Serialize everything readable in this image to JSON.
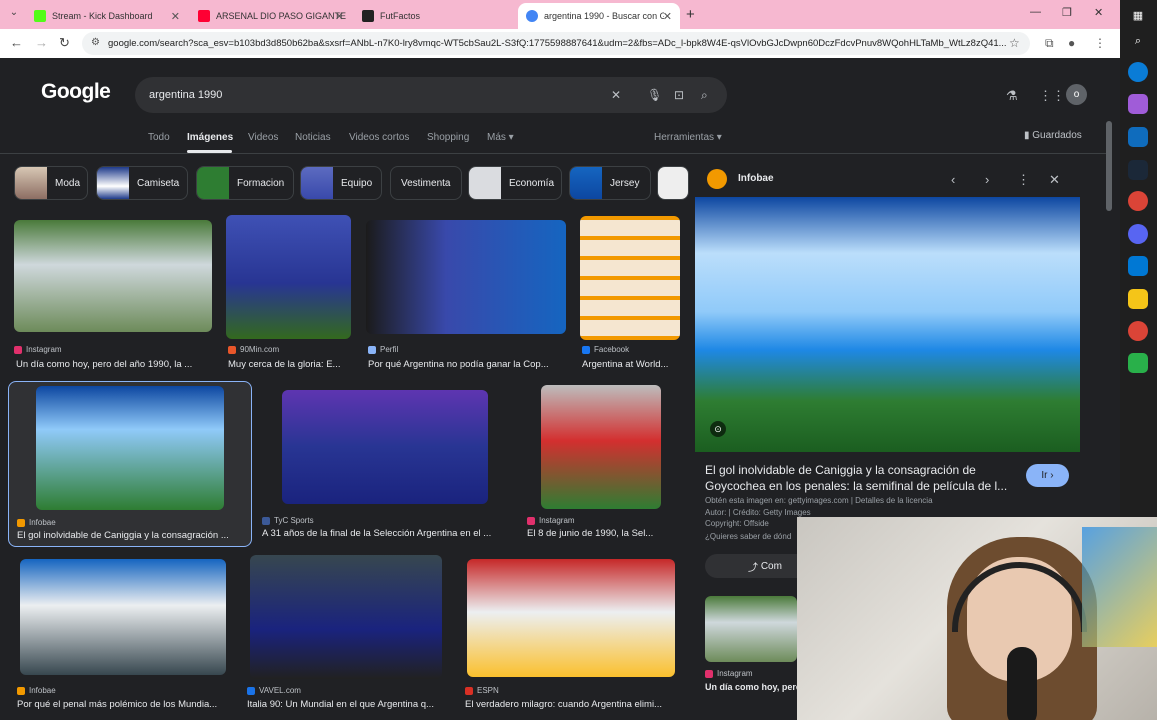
{
  "browser": {
    "tabs": [
      {
        "label": "Stream - Kick Dashboard",
        "color": "#53fc18"
      },
      {
        "label": "ARSENAL DIO PASO GIGANTE",
        "color": "#ff0033"
      },
      {
        "label": "FutFactos",
        "color": "#222222"
      },
      {
        "label": "argentina 1990 - Buscar con Go",
        "color": "#4285f4"
      }
    ],
    "url": "google.com/search?sca_esv=b103bd3d850b62ba&sxsrf=ANbL-n7K0-lry8vmqc-WT5cbSau2L-S3fQ:1775598887641&udm=2&fbs=ADc_l-bpk8W4E-qsVlOvbGJcDwpn60DczFdcvPnuv8WQohHLTaMb_WtLz8zQ41..."
  },
  "google": {
    "logo": "Google",
    "query": "argentina 1990",
    "avatar_letter": "o",
    "saved_label": "Guardados",
    "tabs": [
      "Todo",
      "Imágenes",
      "Videos",
      "Noticias",
      "Videos cortos",
      "Shopping",
      "Más ▾",
      "Herramientas ▾"
    ],
    "chips": [
      "Moda",
      "Camiseta",
      "Formacion",
      "Equipo",
      "Vestimenta",
      "Economía",
      "Jersey"
    ]
  },
  "results": [
    {
      "source": "Instagram",
      "title": "Un día como hoy, pero del año 1990, la ...",
      "src_color": "#e1306c"
    },
    {
      "source": "90Min.com",
      "title": "Muy cerca de la gloria: E...",
      "src_color": "#e8562a"
    },
    {
      "source": "Perfil",
      "title": "Por qué Argentina no podía ganar la Cop...",
      "src_color": "#8ab4f8"
    },
    {
      "source": "Facebook",
      "title": "Argentina at World...",
      "src_color": "#1877f2"
    },
    {
      "source": "Infobae",
      "title": "El gol inolvidable de Caniggia y la consagración ...",
      "src_color": "#f29900"
    },
    {
      "source": "TyC Sports",
      "title": "A 31 años de la final de la Selección Argentina en el ...",
      "src_color": "#3b5998"
    },
    {
      "source": "Instagram",
      "title": "El 8 de junio de 1990, la Sel...",
      "src_color": "#e1306c"
    },
    {
      "source": "Infobae",
      "title": "Por qué el penal más polémico de los Mundia...",
      "src_color": "#f29900"
    },
    {
      "source": "VAVEL.com",
      "title": "Italia 90: Un Mundial en el que Argentina q...",
      "src_color": "#1a73e8"
    },
    {
      "source": "ESPN",
      "title": "El verdadero milagro: cuando Argentina elimi...",
      "src_color": "#d93025"
    }
  ],
  "preview": {
    "source": "Infobae",
    "title": "El gol inolvidable de Caniggia y la consagración de Goycochea en los penales: la semifinal de película de l...",
    "ir_label": "Ir",
    "meta_line1": "Obtén esta imagen en: gettyimages.com | Detalles de la licencia",
    "meta_line2": "Autor: | Crédito: Getty Images",
    "meta_line3": "Copyright: Offside",
    "meta_line4": "¿Quieres saber de dónd",
    "share_label": "Com",
    "related_source": "Instagram",
    "related_title": "Un día como hoy, pero"
  }
}
